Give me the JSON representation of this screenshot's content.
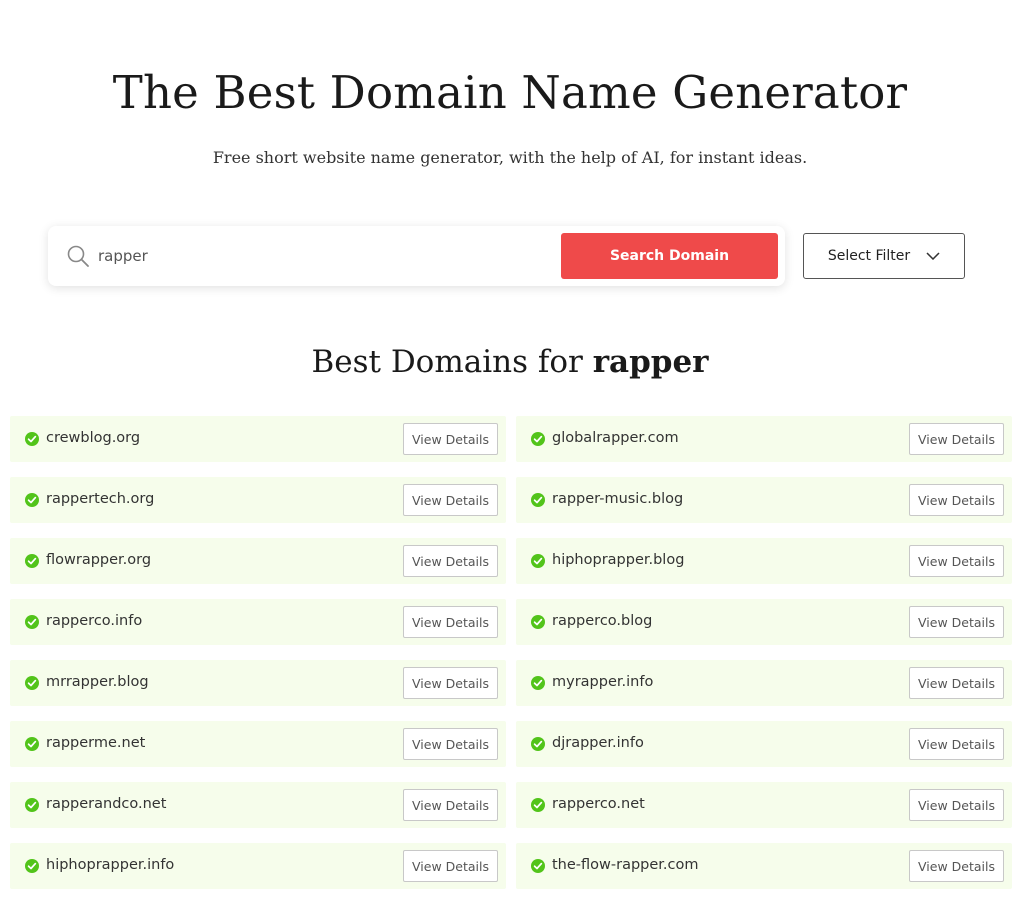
{
  "header": {
    "title": "The Best Domain Name Generator",
    "subtitle": "Free short website name generator, with the help of AI, for instant ideas."
  },
  "search": {
    "value": "rapper",
    "button_label": "Search Domain",
    "filter_label": "Select Filter",
    "icon": "search-icon"
  },
  "results": {
    "heading_prefix": "Best Domains for ",
    "keyword": "rapper",
    "view_details_label": "View Details",
    "status_icon": "check-circle-icon",
    "status_color": "#52c41a",
    "row_background": "#f6fdeb",
    "items": [
      {
        "domain": "crewblog.org"
      },
      {
        "domain": "globalrapper.com"
      },
      {
        "domain": "rappertech.org"
      },
      {
        "domain": "rapper-music.blog"
      },
      {
        "domain": "flowrapper.org"
      },
      {
        "domain": "hiphoprapper.blog"
      },
      {
        "domain": "rapperco.info"
      },
      {
        "domain": "rapperco.blog"
      },
      {
        "domain": "mrrapper.blog"
      },
      {
        "domain": "myrapper.info"
      },
      {
        "domain": "rapperme.net"
      },
      {
        "domain": "djrapper.info"
      },
      {
        "domain": "rapperandco.net"
      },
      {
        "domain": "rapperco.net"
      },
      {
        "domain": "hiphoprapper.info"
      },
      {
        "domain": "the-flow-rapper.com"
      }
    ]
  },
  "colors": {
    "accent": "#ef4a4a",
    "text": "#1a1a1a"
  }
}
